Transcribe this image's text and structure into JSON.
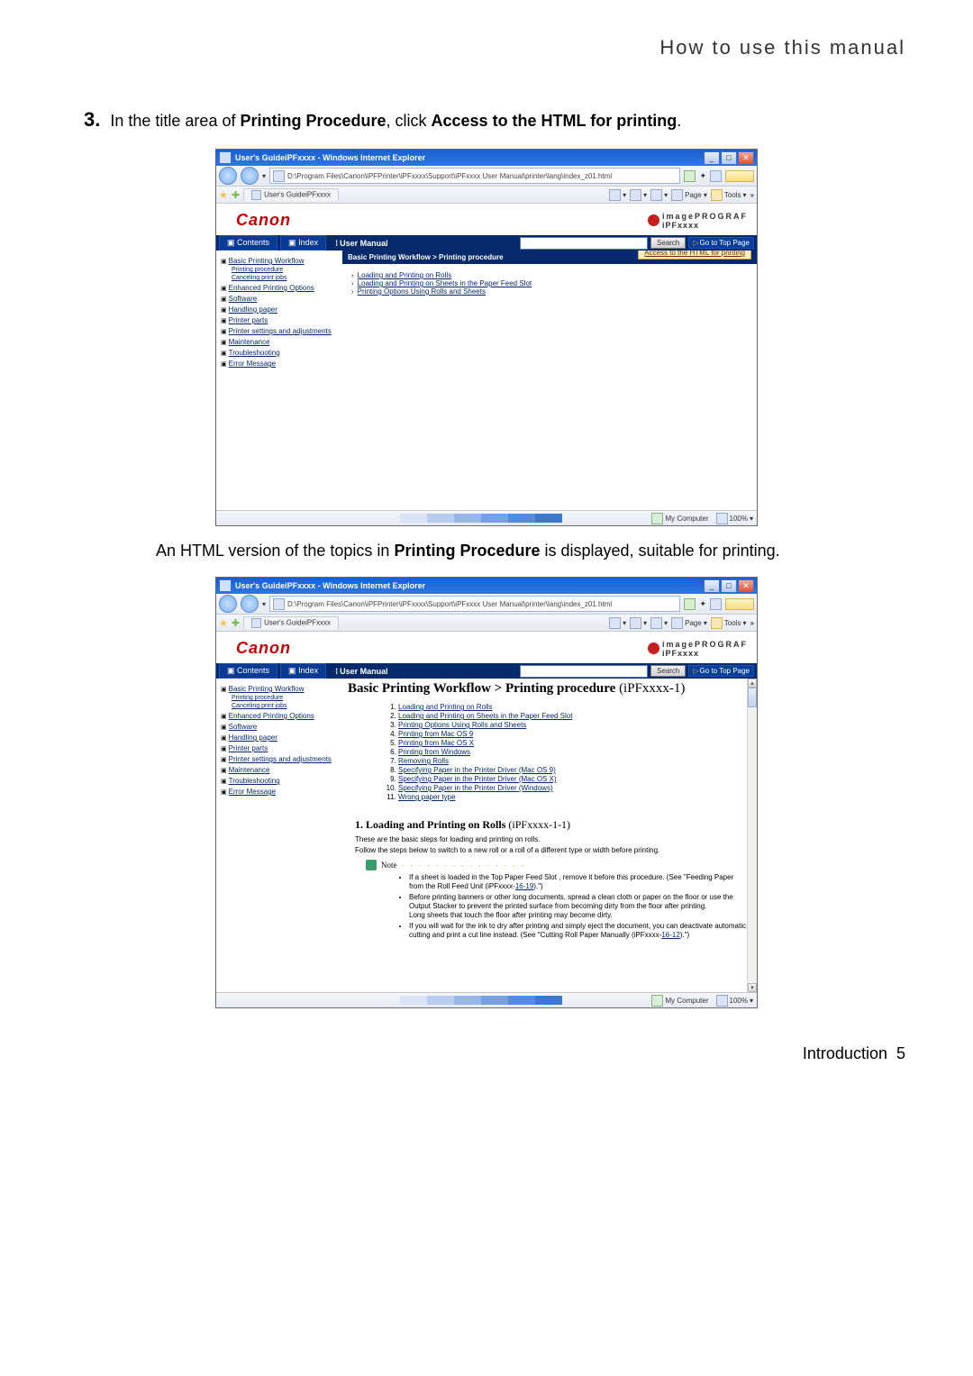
{
  "header": {
    "title": "How to use this manual"
  },
  "step": {
    "number": "3.",
    "pre": "In the title area of ",
    "b1": "Printing Procedure",
    "mid": ", click ",
    "b2": "Access to the HTML for printing",
    "post": "."
  },
  "shot": {
    "windowTitle": "User's GuideiPFxxxx - Windows Internet Explorer",
    "address": "D:\\Program Files\\Canon\\iPFPrinter\\iPFxxxx\\Support\\iPFxxxx User Manual\\printer\\lang\\index_z01.html",
    "tab": "User's GuideiPFxxxx",
    "toolbarPage": "Page",
    "toolbarTools": "Tools",
    "brand": "Canon",
    "prografTop": "imagePROGRAF",
    "prografSub": "iPFxxxx",
    "tabContents": "Contents",
    "tabIndex": "Index",
    "userManual": "User Manual",
    "searchBtn": "Search",
    "gotoTop": "Go to Top Page",
    "accessHtml": "Access to the HTML for printing",
    "sidebar": {
      "topcat": "Basic Printing Workflow",
      "sub1": "Printing procedure",
      "sub2": "Canceling print jobs",
      "items": [
        "Enhanced Printing Options",
        "Software",
        "Handling paper",
        "Printer parts",
        "Printer settings and adjustments",
        "Maintenance",
        "Troubleshooting",
        "Error Message"
      ]
    },
    "breadcrumb": "Basic Printing Workflow > Printing procedure",
    "mainLinks": [
      "Loading and Printing on Rolls",
      "Loading and Printing on Sheets in the Paper Feed Slot",
      "Printing Options Using Rolls and Sheets"
    ],
    "zone": "My Computer",
    "zoom": "100%"
  },
  "after": {
    "pre": "An HTML version of the topics in ",
    "b": "Printing Procedure",
    "post": " is displayed, suitable for printing."
  },
  "shot2": {
    "bigTitle": "Basic Printing Workflow > Printing procedure ",
    "bigTitleSuffix": "(iPFxxxx-1)",
    "numlinks": [
      "Loading and Printing on Rolls",
      "Loading and Printing on Sheets in the Paper Feed Slot",
      "Printing Options Using Rolls and Sheets",
      "Printing from Mac OS 9",
      "Printing from Mac OS X",
      "Printing from Windows",
      "Removing Rolls",
      "Specifying Paper in the Printer Driver (Mac OS 9)",
      "Specifying Paper in the Printer Driver (Mac OS X)",
      "Specifying Paper in the Printer Driver (Windows)",
      "Wrong paper type"
    ],
    "subTitlePrefix": "1.  Loading and Printing on Rolls ",
    "subTitleSuffix": "(iPFxxxx-1-1)",
    "para1": "These are the basic steps for loading and printing on rolls.",
    "para2": "Follow the steps below to switch to a new roll or a roll of a different type or width before printing.",
    "noteLabel": "Note",
    "bullets": [
      {
        "text": "If a sheet is loaded in the Top Paper Feed Slot , remove it before this procedure. (See \"Feeding Paper from the Roll Feed Unit (iPFxxxx-",
        "link": "16-19",
        "tail": ").\")"
      },
      {
        "text": "Before printing banners or other long documents, spread a clean cloth or paper on the floor or use the Output Stacker to prevent the printed surface from becoming dirty from the floor after printing.\nLong sheets that touch the floor after printing may become dirty."
      },
      {
        "text": "If you will wait for the ink to dry after printing and simply eject the document, you can deactivate automatic cutting and print a cut line instead. (See \"Cutting Roll Paper Manually (iPFxxxx-",
        "link": "16-12",
        "tail": ").\")"
      }
    ]
  },
  "footer": {
    "label": "Introduction",
    "page": "5"
  }
}
